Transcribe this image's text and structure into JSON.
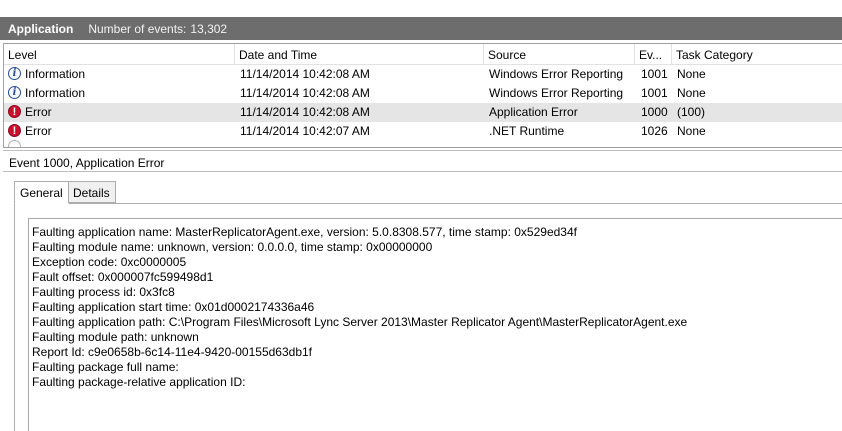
{
  "header": {
    "log_name": "Application",
    "count_label": "Number of events:",
    "count_value": "13,302"
  },
  "columns": [
    "Level",
    "Date and Time",
    "Source",
    "Ev...",
    "Task Category"
  ],
  "rows": [
    {
      "icon": "information-icon",
      "level": "Information",
      "datetime": "11/14/2014 10:42:08 AM",
      "source": "Windows Error Reporting",
      "event_id": "1001",
      "task": "None",
      "selected": false
    },
    {
      "icon": "information-icon",
      "level": "Information",
      "datetime": "11/14/2014 10:42:08 AM",
      "source": "Windows Error Reporting",
      "event_id": "1001",
      "task": "None",
      "selected": false
    },
    {
      "icon": "error-icon",
      "level": "Error",
      "datetime": "11/14/2014 10:42:08 AM",
      "source": "Application Error",
      "event_id": "1000",
      "task": "(100)",
      "selected": true
    },
    {
      "icon": "error-icon",
      "level": "Error",
      "datetime": "11/14/2014 10:42:07 AM",
      "source": ".NET Runtime",
      "event_id": "1026",
      "task": "None",
      "selected": false
    }
  ],
  "detail": {
    "title": "Event 1000, Application Error",
    "tabs": [
      "General",
      "Details"
    ],
    "active_tab": "General",
    "lines": [
      "Faulting application name: MasterReplicatorAgent.exe, version: 5.0.8308.577, time stamp: 0x529ed34f",
      "Faulting module name: unknown, version: 0.0.0.0, time stamp: 0x00000000",
      "Exception code: 0xc0000005",
      "Fault offset: 0x000007fc599498d1",
      "Faulting process id: 0x3fc8",
      "Faulting application start time: 0x01d0002174336a46",
      "Faulting application path: C:\\Program Files\\Microsoft Lync Server 2013\\Master Replicator Agent\\MasterReplicatorAgent.exe",
      "Faulting module path: unknown",
      "Report Id: c9e0658b-6c14-11e4-9420-00155d63db1f",
      "Faulting package full name:",
      "Faulting package-relative application ID:"
    ]
  },
  "colors": {
    "title_bar": "#6d6d6d",
    "selected_row": "#e5e5e5",
    "error_red": "#c8102e",
    "info_blue": "#2b4d93"
  }
}
